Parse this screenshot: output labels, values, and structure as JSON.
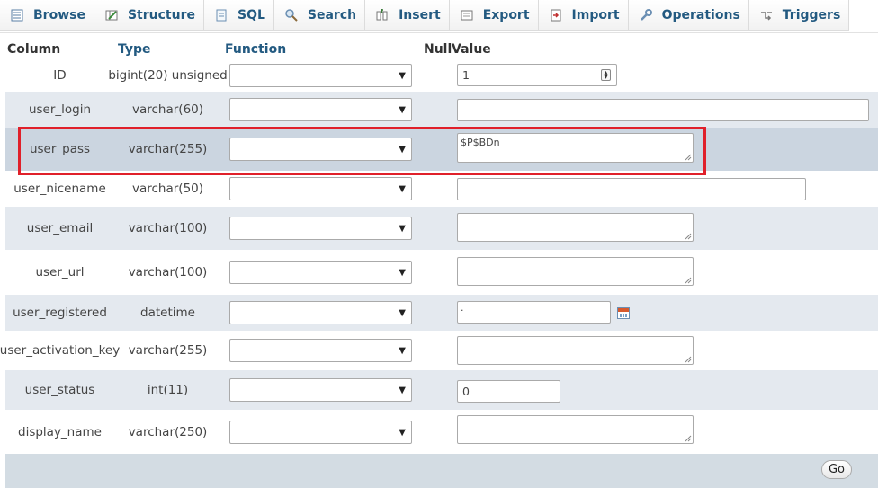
{
  "tabs": [
    {
      "label": "Browse",
      "icon": "browse-icon"
    },
    {
      "label": "Structure",
      "icon": "structure-icon"
    },
    {
      "label": "SQL",
      "icon": "sql-icon"
    },
    {
      "label": "Search",
      "icon": "search-icon"
    },
    {
      "label": "Insert",
      "icon": "insert-icon"
    },
    {
      "label": "Export",
      "icon": "export-icon"
    },
    {
      "label": "Import",
      "icon": "import-icon"
    },
    {
      "label": "Operations",
      "icon": "wrench-icon"
    },
    {
      "label": "Triggers",
      "icon": "triggers-icon"
    }
  ],
  "headers": {
    "column": "Column",
    "type": "Type",
    "function": "Function",
    "null": "Null",
    "value": "Value"
  },
  "rows": [
    {
      "name": "ID",
      "type": "bigint(20) unsigned",
      "function": "",
      "value": "1"
    },
    {
      "name": "user_login",
      "type": "varchar(60)",
      "function": "",
      "value": ""
    },
    {
      "name": "user_pass",
      "type": "varchar(255)",
      "function": "",
      "value": "$P$BDn"
    },
    {
      "name": "user_nicename",
      "type": "varchar(50)",
      "function": "",
      "value": ""
    },
    {
      "name": "user_email",
      "type": "varchar(100)",
      "function": "",
      "value": ""
    },
    {
      "name": "user_url",
      "type": "varchar(100)",
      "function": "",
      "value": ""
    },
    {
      "name": "user_registered",
      "type": "datetime",
      "function": "",
      "value": "·"
    },
    {
      "name": "user_activation_key",
      "type": "varchar(255)",
      "function": "",
      "value": ""
    },
    {
      "name": "user_status",
      "type": "int(11)",
      "function": "",
      "value": "0"
    },
    {
      "name": "display_name",
      "type": "varchar(250)",
      "function": "",
      "value": ""
    }
  ],
  "go_label": "Go",
  "colors": {
    "accent": "#235a81",
    "highlight": "#e0202a",
    "alt_row": "#e4e9ef"
  }
}
